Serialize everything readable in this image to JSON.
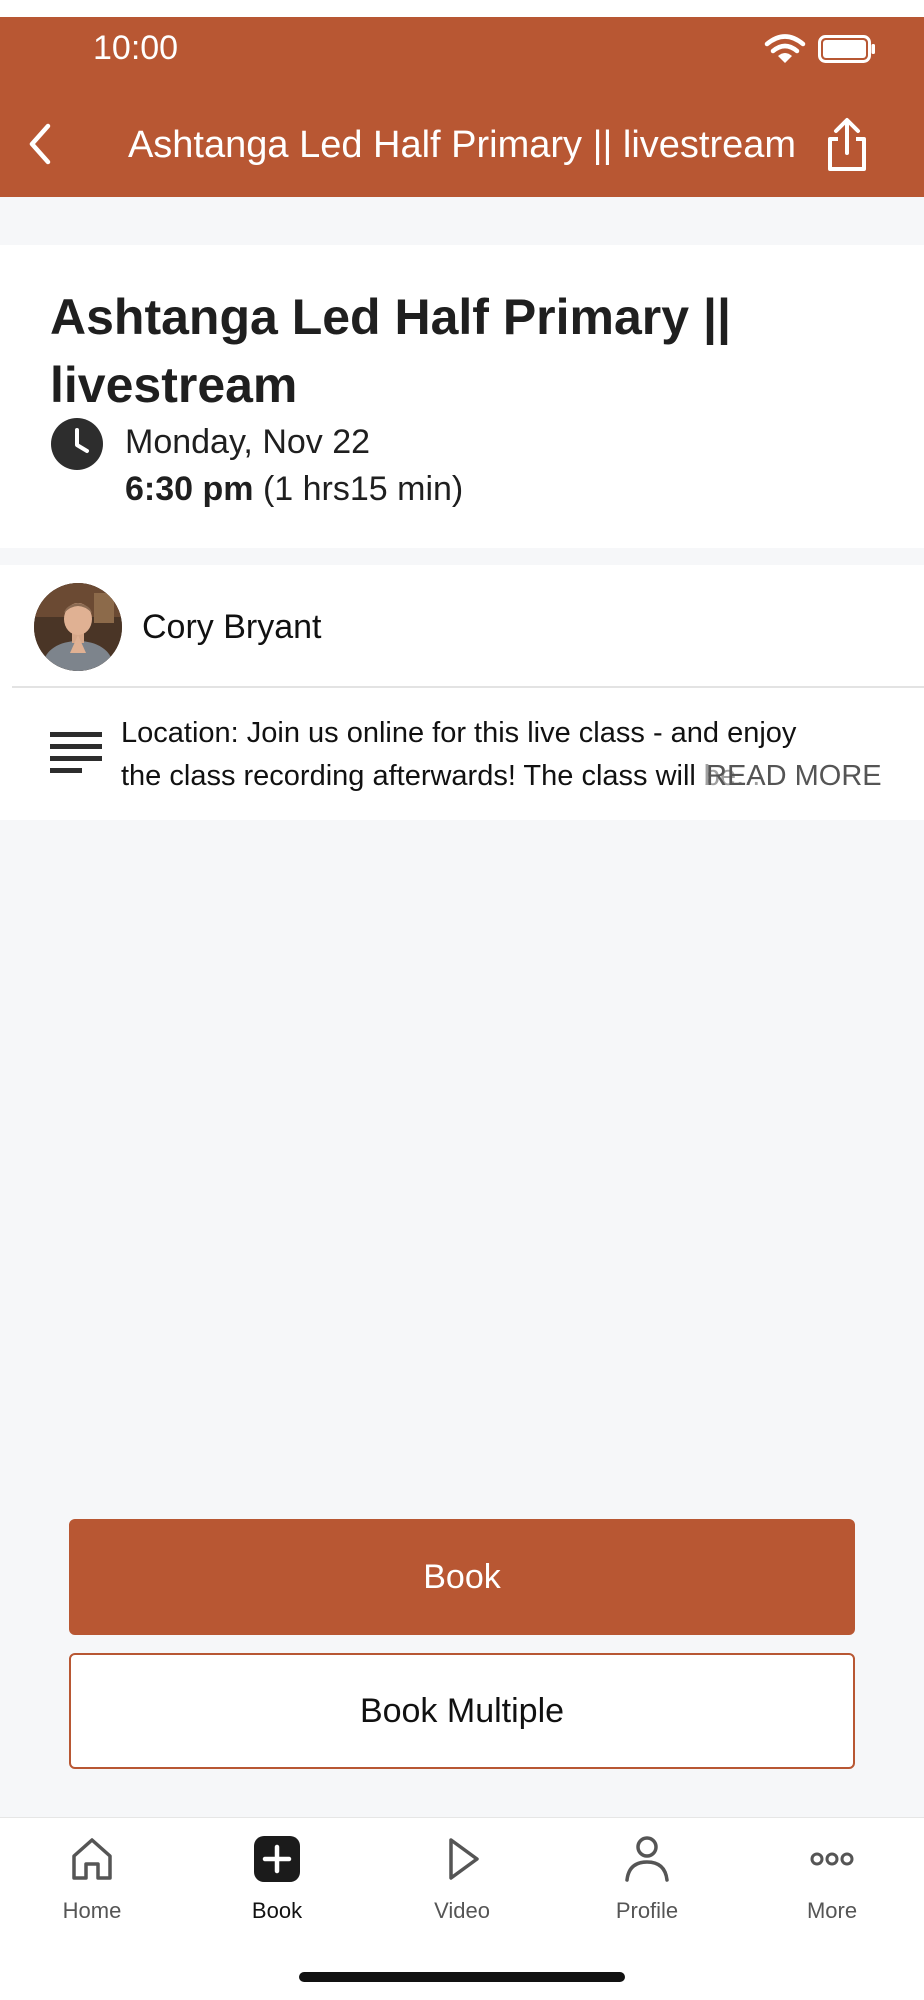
{
  "status_bar": {
    "time": "10:00",
    "icons": [
      "wifi-icon",
      "battery-icon"
    ]
  },
  "header": {
    "title": "Ashtanga Led Half Primary || livestream",
    "back_icon": "chevron-left-icon",
    "share_icon": "share-icon"
  },
  "class_info": {
    "title": "Ashtanga Led Half Primary || livestream",
    "date": "Monday, Nov 22",
    "time": "6:30 pm",
    "duration": "(1 hrs15 min)",
    "clock_icon": "clock-icon"
  },
  "instructor": {
    "name": "Cory Bryant"
  },
  "description": {
    "text": "Location: Join us online for this live class - and enjoy the class recording afterwards! The class will be...",
    "read_more": "READ MORE",
    "icon": "text-lines-icon"
  },
  "actions": {
    "book_label": "Book",
    "book_multiple_label": "Book Multiple"
  },
  "tabbar": {
    "items": [
      {
        "label": "Home",
        "icon": "home-icon"
      },
      {
        "label": "Book",
        "icon": "plus-square-icon",
        "active": true
      },
      {
        "label": "Video",
        "icon": "play-icon"
      },
      {
        "label": "Profile",
        "icon": "person-icon"
      },
      {
        "label": "More",
        "icon": "more-dots-icon"
      }
    ]
  },
  "colors": {
    "brand": "#b85733",
    "background": "#f6f7f9",
    "card": "#ffffff"
  }
}
